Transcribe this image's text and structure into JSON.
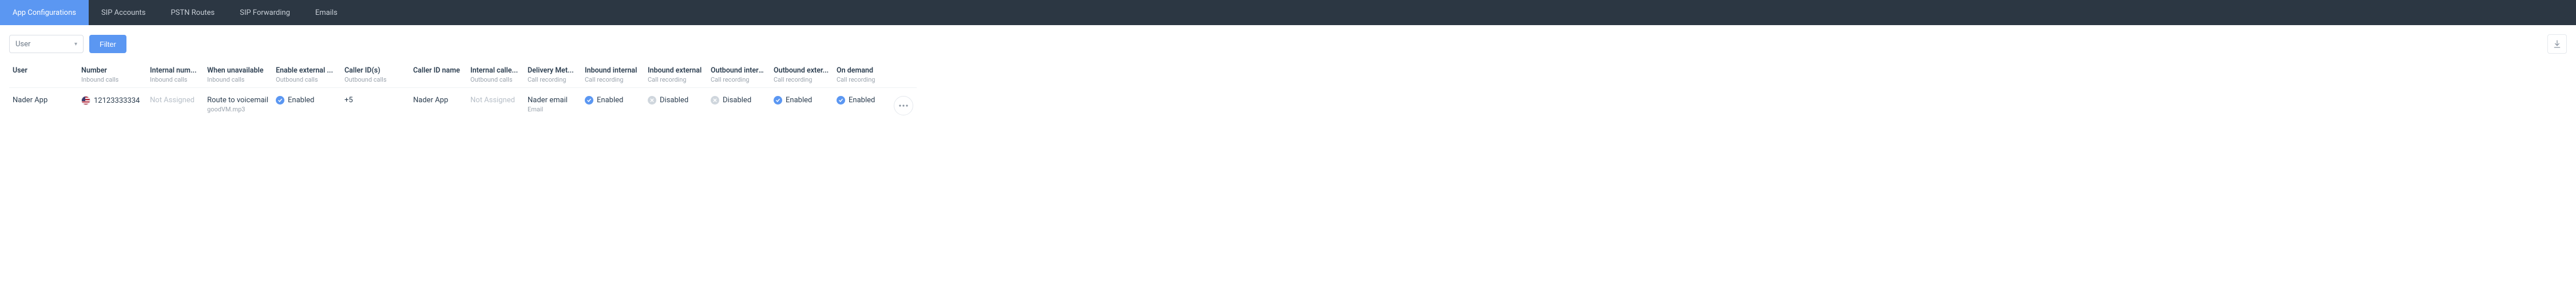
{
  "tabs": [
    {
      "label": "App Configurations",
      "active": true
    },
    {
      "label": "SIP Accounts",
      "active": false
    },
    {
      "label": "PSTN Routes",
      "active": false
    },
    {
      "label": "SIP Forwarding",
      "active": false
    },
    {
      "label": "Emails",
      "active": false
    }
  ],
  "toolbar": {
    "filter_select": "User",
    "filter_button": "Filter"
  },
  "columns": [
    {
      "title": "User",
      "sub": ""
    },
    {
      "title": "Number",
      "sub": "Inbound calls"
    },
    {
      "title": "Internal num...",
      "sub": "Inbound calls"
    },
    {
      "title": "When unavailable",
      "sub": "Inbound calls"
    },
    {
      "title": "Enable external ...",
      "sub": "Outbound calls"
    },
    {
      "title": "Caller ID(s)",
      "sub": "Outbound calls"
    },
    {
      "title": "Caller ID name",
      "sub": ""
    },
    {
      "title": "Internal calle...",
      "sub": "Outbound calls"
    },
    {
      "title": "Delivery Met...",
      "sub": "Call recording"
    },
    {
      "title": "Inbound internal",
      "sub": "Call recording"
    },
    {
      "title": "Inbound external",
      "sub": "Call recording"
    },
    {
      "title": "Outbound internal",
      "sub": "Call recording"
    },
    {
      "title": "Outbound exter...",
      "sub": "Call recording"
    },
    {
      "title": "On demand",
      "sub": "Call recording"
    }
  ],
  "row": {
    "user": "Nader App",
    "number": "12123333334",
    "internal_number": "Not Assigned",
    "when_unavailable": "Route to voicemail",
    "when_unavailable_sub": "goodVM.mp3",
    "enable_external": {
      "state": "on",
      "label": "Enabled"
    },
    "caller_ids": "+5",
    "caller_id_name": "Nader App",
    "internal_caller": "Not Assigned",
    "delivery_method": "Nader email",
    "delivery_method_sub": "Email",
    "inbound_internal": {
      "state": "on",
      "label": "Enabled"
    },
    "inbound_external": {
      "state": "off",
      "label": "Disabled"
    },
    "outbound_internal": {
      "state": "off",
      "label": "Disabled"
    },
    "outbound_external": {
      "state": "on",
      "label": "Enabled"
    },
    "on_demand": {
      "state": "on",
      "label": "Enabled"
    }
  }
}
